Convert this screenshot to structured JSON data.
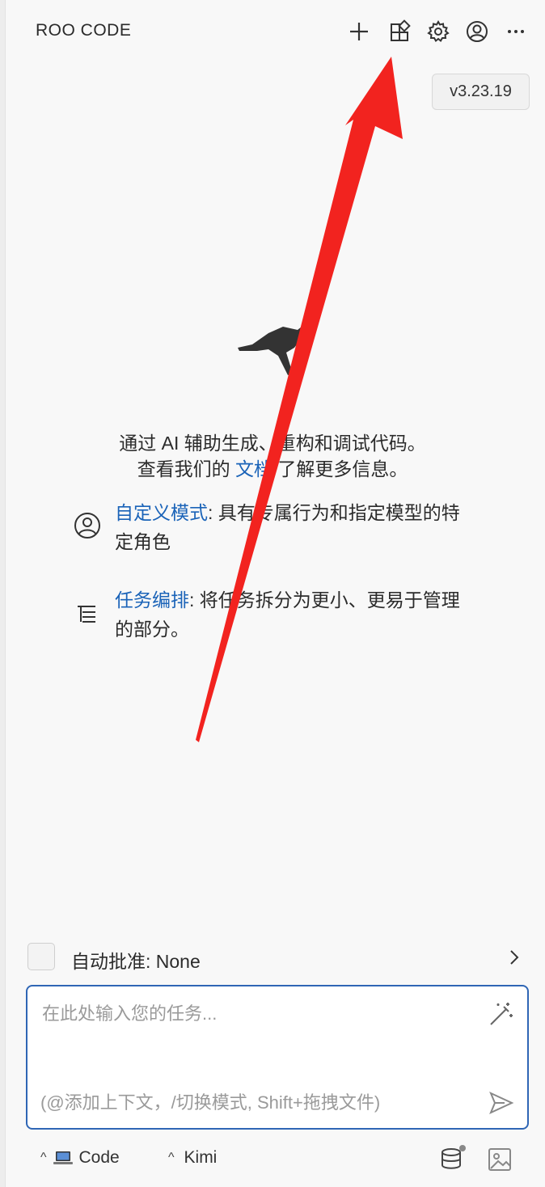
{
  "header": {
    "title": "ROO CODE"
  },
  "toolbar": {
    "icons": [
      "plus-icon",
      "marketplace-icon",
      "gear-icon",
      "account-icon",
      "more-icon"
    ]
  },
  "version": {
    "label": "v3.23.19"
  },
  "intro": {
    "line1": "通过 AI 辅助生成、重构和调试代码。",
    "line2_prefix": "查看我们的 ",
    "line2_link": "文档",
    "line2_suffix": " 了解更多信息。"
  },
  "features": [
    {
      "icon": "account-circle-icon",
      "link": "自定义模式",
      "text": ": 具有专属行为和指定模型的特定角色"
    },
    {
      "icon": "list-tree-icon",
      "link": "任务编排",
      "text": ": 将任务拆分为更小、更易于管理的部分。"
    }
  ],
  "auto_approve": {
    "label": "自动批准: None"
  },
  "input": {
    "placeholder": "在此处输入您的任务...",
    "hint": "(@添加上下文，/切换模式, Shift+拖拽文件)"
  },
  "footer": {
    "mode": "Code",
    "model": "Kimi"
  },
  "colors": {
    "accent": "#2f66b5",
    "link": "#1a63b8",
    "arrow": "#f2231f"
  }
}
